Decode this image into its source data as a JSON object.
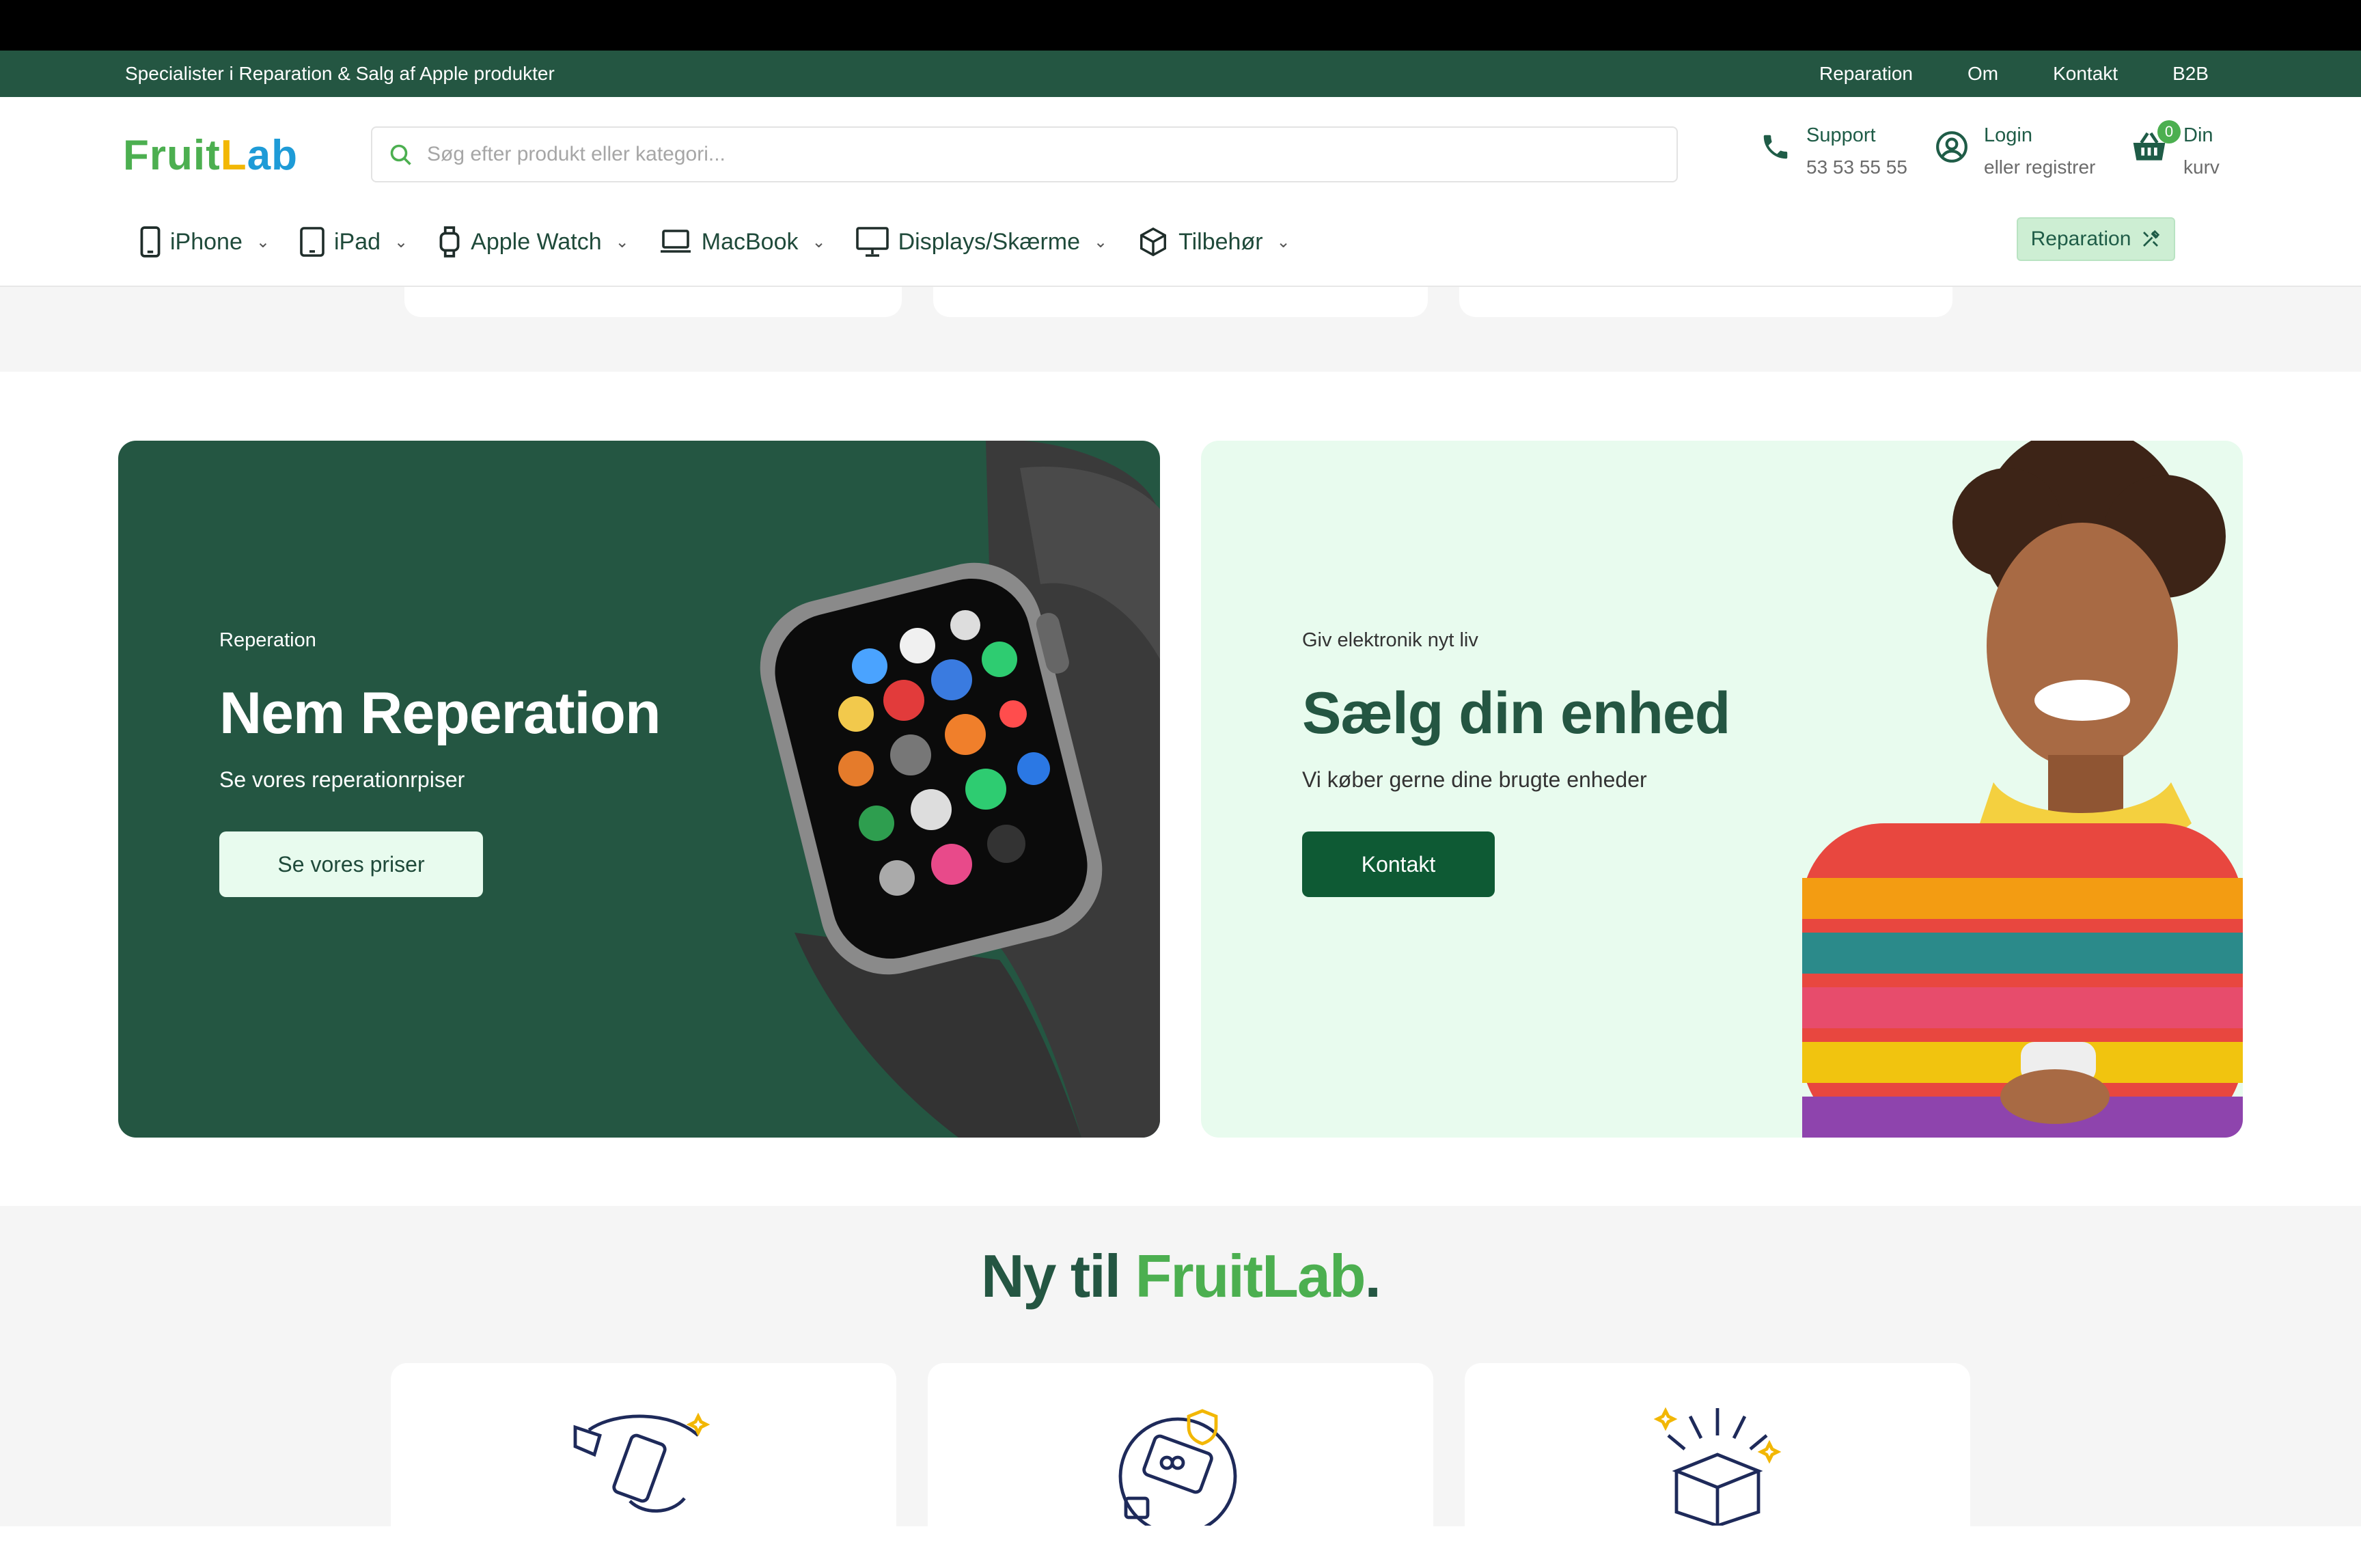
{
  "topbar": {
    "tagline": "Specialister i Reparation & Salg af Apple produkter",
    "links": [
      "Reparation",
      "Om",
      "Kontakt",
      "B2B"
    ]
  },
  "header": {
    "logo": {
      "part1": "Fruit",
      "part2": "L",
      "part3": "ab"
    },
    "search_placeholder": "Søg efter produkt eller kategori...",
    "support": {
      "label": "Support",
      "phone": "53 53 55 55"
    },
    "login": {
      "label": "Login",
      "sub": "eller registrer"
    },
    "cart": {
      "count": "0",
      "label1": "Din",
      "label2": "kurv"
    }
  },
  "nav": {
    "items": [
      {
        "label": "iPhone",
        "icon": "iphone-icon"
      },
      {
        "label": "iPad",
        "icon": "ipad-icon"
      },
      {
        "label": "Apple Watch",
        "icon": "watch-icon"
      },
      {
        "label": "MacBook",
        "icon": "laptop-icon"
      },
      {
        "label": "Displays/Skærme",
        "icon": "monitor-icon"
      },
      {
        "label": "Tilbehør",
        "icon": "box-icon"
      }
    ],
    "repair_button": "Reparation"
  },
  "banners": [
    {
      "kicker": "Reperation",
      "title": "Nem Reperation",
      "subtitle": "Se vores reperationrpiser",
      "button": "Se vores priser",
      "image": "apple-watch-image"
    },
    {
      "kicker": "Giv elektronik nyt liv",
      "title": "Sælg din enhed",
      "subtitle": "Vi køber gerne dine brugte enheder",
      "button": "Kontakt",
      "image": "woman-with-phone-image"
    }
  ],
  "new_section": {
    "title_prefix": "Ny til ",
    "title_brand": "FruitLab",
    "title_suffix": "."
  },
  "colors": {
    "primary": "#245642",
    "accent": "#4caf50",
    "light": "#e8fbee"
  }
}
